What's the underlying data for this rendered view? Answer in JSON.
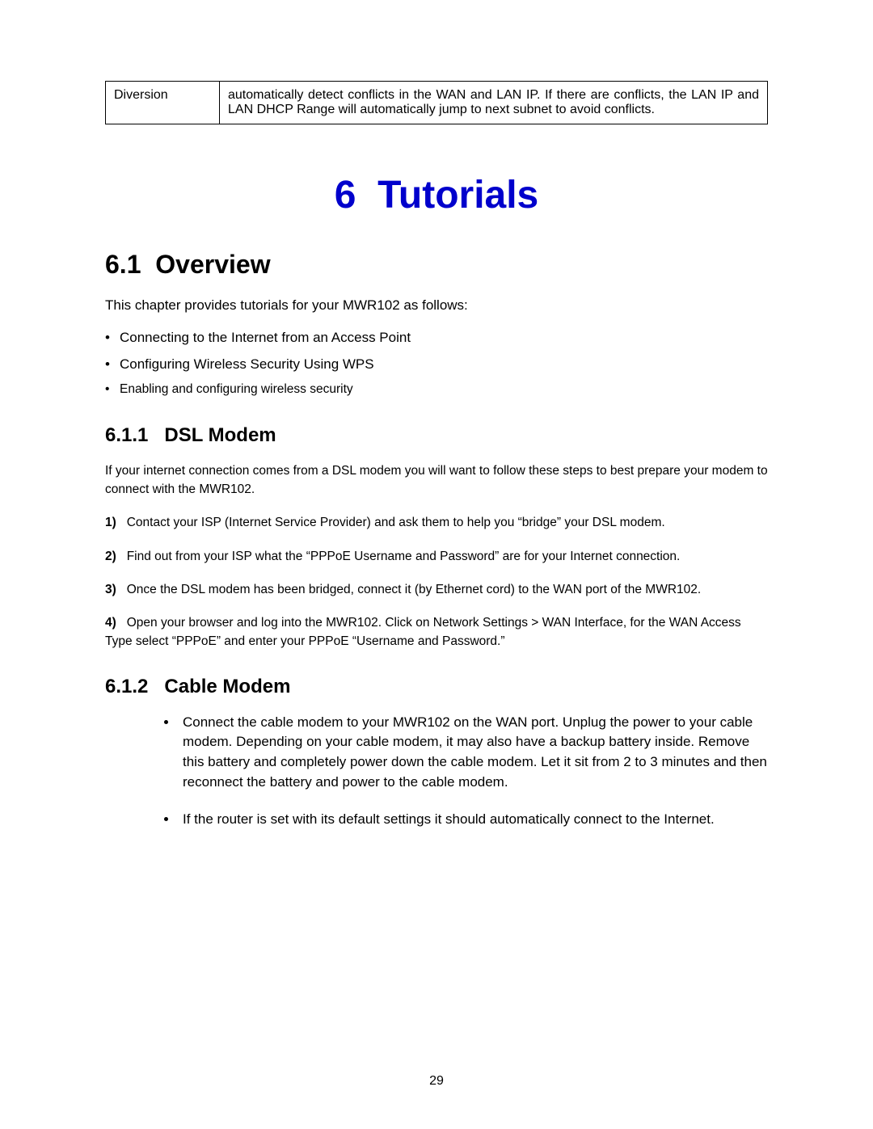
{
  "table": {
    "left": "Diversion",
    "right": "automatically detect conflicts in the WAN and LAN IP. If there are conflicts, the LAN IP and LAN DHCP Range will automatically jump to next subnet to avoid conflicts."
  },
  "chapter": {
    "number": "6",
    "title": "Tutorials"
  },
  "section_6_1": {
    "number": "6.1",
    "title": "Overview",
    "intro": "This chapter provides tutorials for your MWR102 as follows:",
    "bullets": [
      "Connecting to the Internet from an Access Point",
      "Configuring Wireless Security Using WPS",
      "Enabling and configuring wireless security"
    ]
  },
  "section_6_1_1": {
    "number": "6.1.1",
    "title": "DSL Modem",
    "intro": "If your internet connection comes from a DSL modem you will want to follow these steps to best prepare your modem to connect with the MWR102.",
    "steps": [
      {
        "num": "1)",
        "text": "Contact your ISP (Internet Service Provider) and ask them to help you “bridge” your DSL modem."
      },
      {
        "num": "2)",
        "text": "Find out from your ISP what the “PPPoE Username and Password” are for your Internet connection."
      },
      {
        "num": "3)",
        "text": "Once the DSL modem has been bridged, connect it (by Ethernet cord) to the WAN port of the MWR102."
      },
      {
        "num": "4)",
        "text": "Open your browser and log into the MWR102. Click on Network Settings > WAN Interface, for the WAN Access Type select “PPPoE” and enter your PPPoE “Username and Password.”"
      }
    ]
  },
  "section_6_1_2": {
    "number": "6.1.2",
    "title": "Cable Modem",
    "bullets": [
      "Connect the cable modem to your MWR102 on the WAN port. Unplug the power to your cable modem. Depending on your cable modem, it may also have a backup battery inside. Remove this battery and completely power down the cable modem. Let it sit from 2 to 3 minutes and then reconnect the battery and power to the cable modem.",
      "If the router is set with its default settings it should automatically connect to the Internet."
    ]
  },
  "page_number": "29"
}
